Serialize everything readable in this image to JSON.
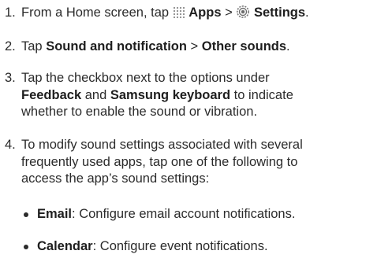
{
  "steps": [
    {
      "num": "1.",
      "t1": "From a Home screen, tap",
      "apps_label": "Apps",
      "sep": ">",
      "settings_label": "Settings",
      "end": "."
    },
    {
      "num": "2.",
      "t1": "Tap",
      "b1": "Sound and notification",
      "sep": ">",
      "b2": "Other sounds",
      "end": "."
    },
    {
      "num": "3.",
      "t1": "Tap the checkbox next to the options under",
      "b1": "Feedback",
      "t2": "and",
      "b2": "Samsung keyboard",
      "t3": "to indicate",
      "t4": "whether to enable the sound or vibration."
    },
    {
      "num": "4.",
      "l1": "To modify sound settings associated with several",
      "l2": "frequently used apps, tap one of the following to",
      "l3": "access the app’s sound settings:"
    }
  ],
  "bullets": [
    {
      "label": "Email",
      "text": ": Configure email account notifications."
    },
    {
      "label": "Calendar",
      "text": ": Configure event notifications."
    }
  ]
}
